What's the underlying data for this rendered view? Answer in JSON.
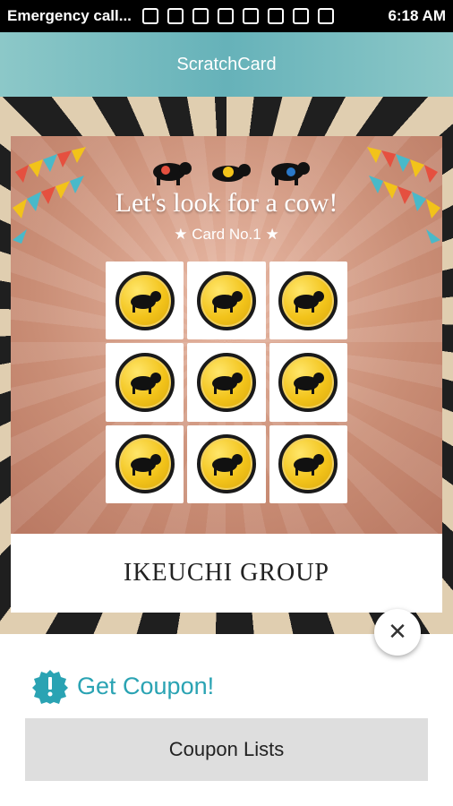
{
  "status_bar": {
    "carrier_text": "Emergency call...",
    "time": "6:18 AM"
  },
  "app": {
    "title": "ScratchCard"
  },
  "card": {
    "heading": "Let's look for a cow!",
    "card_no": "★  Card No.1  ★",
    "grid_rows": 3,
    "grid_cols": 3
  },
  "brand": {
    "name": "IKEUCHI GROUP"
  },
  "bottom_sheet": {
    "get_coupon_label": "Get Coupon!",
    "coupon_lists_button": "Coupon Lists"
  },
  "colors": {
    "accent": "#2aa3b3",
    "coin_fill": "#f2c31a",
    "topbar": "#66b2b9"
  },
  "icons": {
    "close": "close-icon",
    "badge": "exclamation-badge-icon",
    "cow": "cow-icon"
  }
}
